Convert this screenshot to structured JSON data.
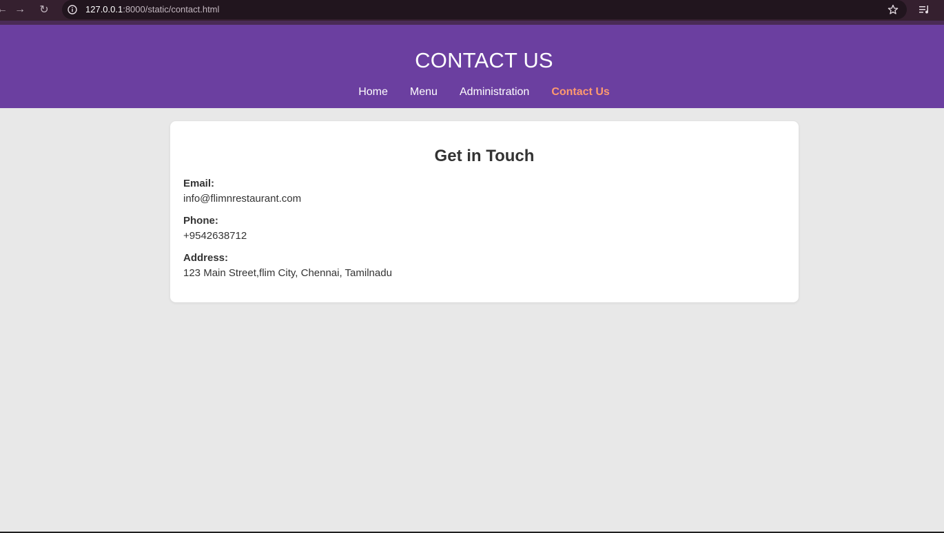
{
  "browser": {
    "url_host": "127.0.0.1",
    "url_path": ":8000/static/contact.html"
  },
  "header": {
    "title": "CONTACT US",
    "nav": [
      {
        "label": "Home",
        "active": false
      },
      {
        "label": "Menu",
        "active": false
      },
      {
        "label": "Administration",
        "active": false
      },
      {
        "label": "Contact Us",
        "active": true
      }
    ]
  },
  "contact": {
    "heading": "Get in Touch",
    "email_label": "Email:",
    "email_value": "info@flimnrestaurant.com",
    "phone_label": "Phone:",
    "phone_value": "+9542638712",
    "address_label": "Address:",
    "address_value": "123 Main Street,flim City, Chennai, Tamilnadu"
  },
  "colors": {
    "header_bg": "#6b3fa0",
    "active_nav": "#ff9a6e",
    "page_bg": "#e8e8e8"
  }
}
